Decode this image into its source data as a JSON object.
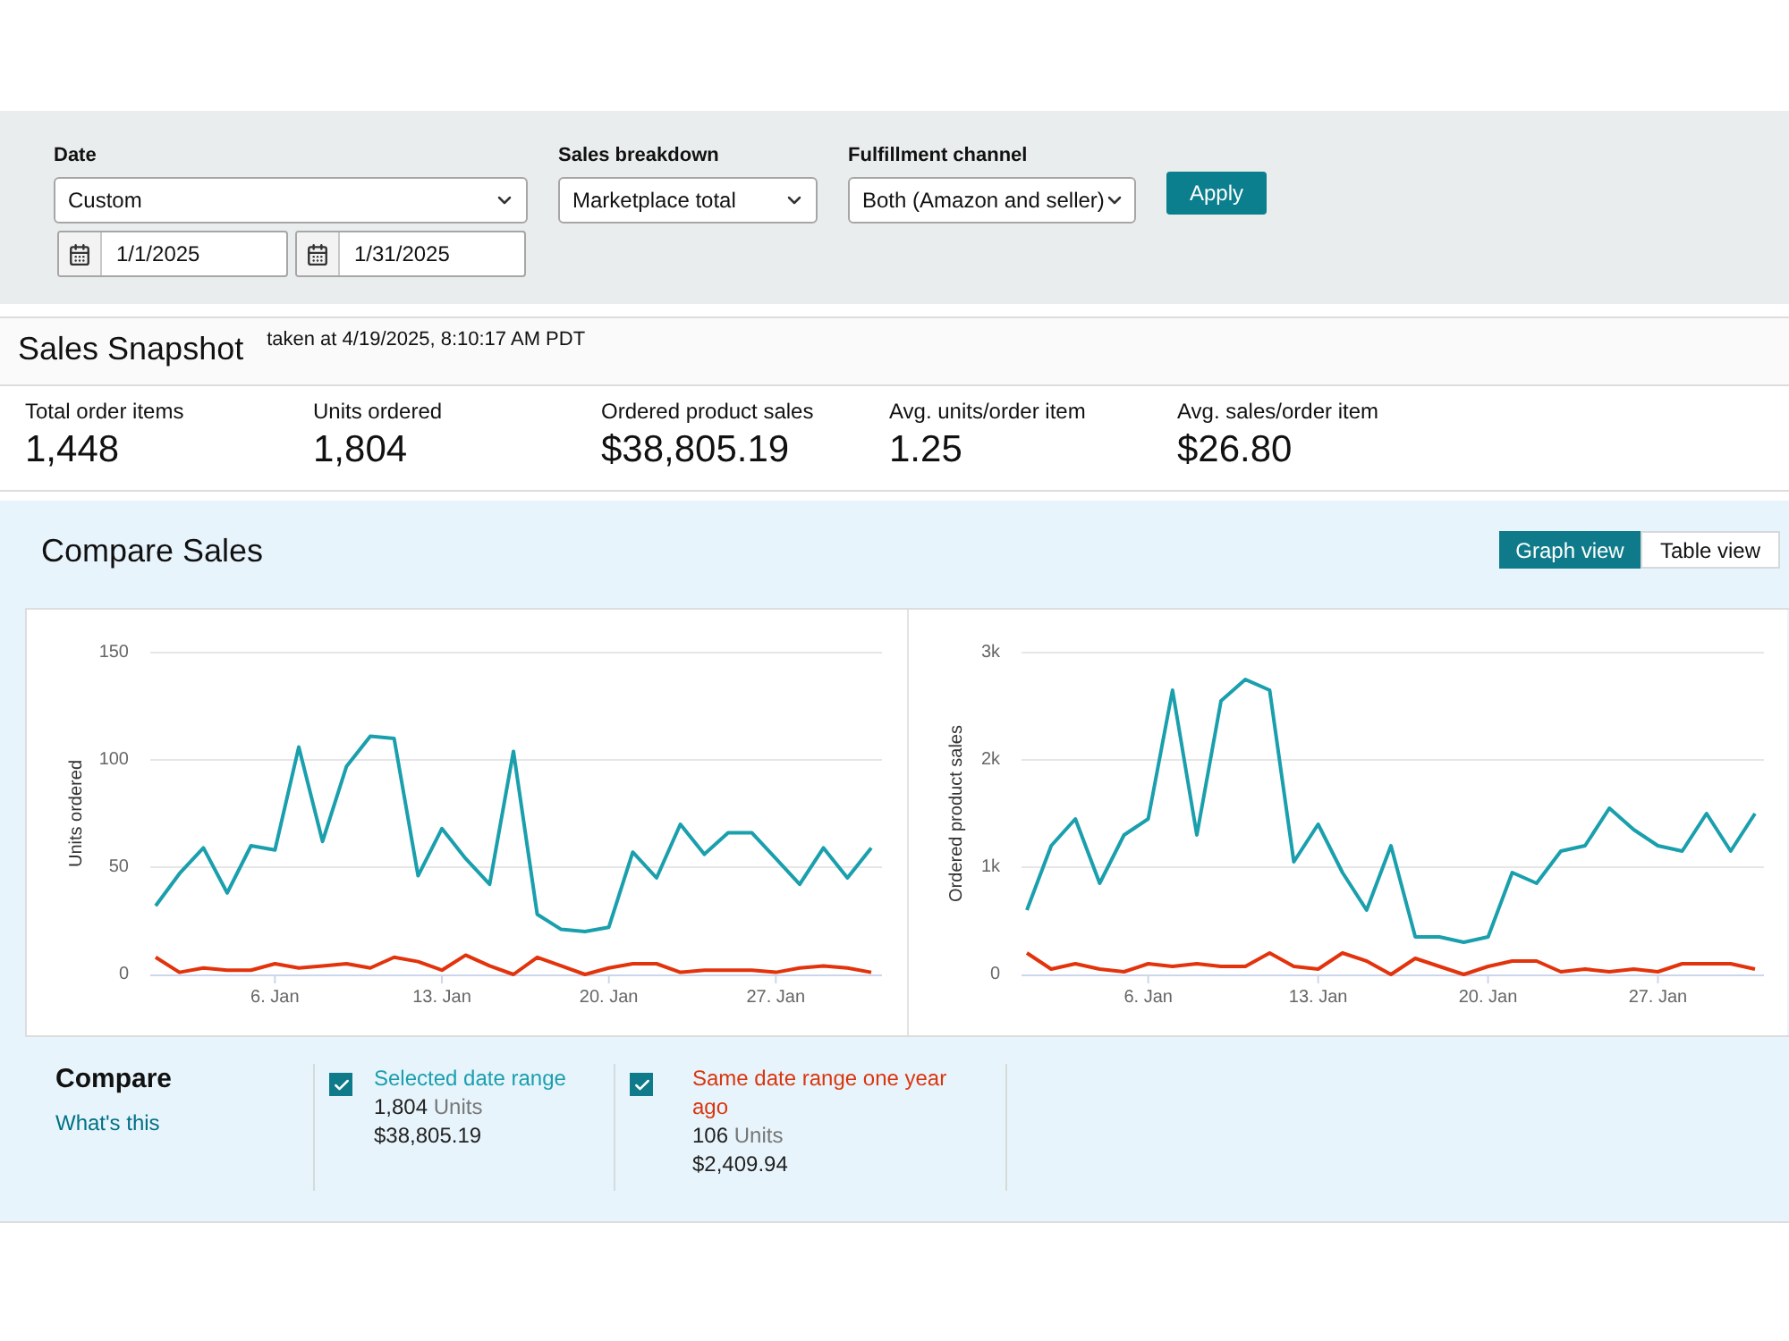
{
  "filters": {
    "date": {
      "label": "Date",
      "value": "Custom",
      "start": "1/1/2025",
      "end": "1/31/2025"
    },
    "sales_breakdown": {
      "label": "Sales breakdown",
      "value": "Marketplace total"
    },
    "fulfillment_channel": {
      "label": "Fulfillment channel",
      "value": "Both (Amazon and seller)"
    },
    "apply_button": "Apply"
  },
  "snapshot": {
    "title": "Sales Snapshot",
    "taken_at": "taken at 4/19/2025, 8:10:17 AM PDT",
    "metrics": [
      {
        "label": "Total order items",
        "value": "1,448"
      },
      {
        "label": "Units ordered",
        "value": "1,804"
      },
      {
        "label": "Ordered product sales",
        "value": "$38,805.19"
      },
      {
        "label": "Avg. units/order item",
        "value": "1.25"
      },
      {
        "label": "Avg. sales/order item",
        "value": "$26.80"
      }
    ]
  },
  "compare_sales": {
    "title": "Compare Sales",
    "view_toggle": [
      {
        "label": "Graph view",
        "selected": true
      },
      {
        "label": "Table view",
        "selected": false
      }
    ],
    "charts": [
      {
        "chart_data": {
          "type": "line",
          "ylabel": "Units ordered",
          "categories": [
            null,
            null,
            null,
            null,
            null,
            "6. Jan",
            null,
            null,
            null,
            null,
            null,
            null,
            "13. Jan",
            null,
            null,
            null,
            null,
            null,
            null,
            "20. Jan",
            null,
            null,
            null,
            null,
            null,
            null,
            "27. Jan",
            null,
            null,
            null,
            null
          ],
          "ylim": [
            0,
            150
          ],
          "yticks": [
            0,
            50,
            100,
            150
          ],
          "series": [
            {
              "color": "#1a9fad",
              "values": [
                32,
                47,
                59,
                38,
                60,
                58,
                106,
                62,
                97,
                111,
                110,
                46,
                68,
                54,
                42,
                104,
                28,
                21,
                20,
                22,
                57,
                45,
                70,
                56,
                66,
                66,
                54,
                42,
                59,
                45,
                59
              ]
            },
            {
              "color": "#e2330c",
              "values": [
                8,
                1,
                3,
                2,
                2,
                5,
                3,
                4,
                5,
                3,
                8,
                6,
                2,
                9,
                4,
                0,
                8,
                4,
                0,
                3,
                5,
                5,
                1,
                2,
                2,
                2,
                1,
                3,
                4,
                3,
                1
              ]
            }
          ]
        }
      },
      {
        "chart_data": {
          "type": "line",
          "ylabel": "Ordered product sales",
          "categories": [
            null,
            null,
            null,
            null,
            null,
            "6. Jan",
            null,
            null,
            null,
            null,
            null,
            null,
            "13. Jan",
            null,
            null,
            null,
            null,
            null,
            null,
            "20. Jan",
            null,
            null,
            null,
            null,
            null,
            null,
            "27. Jan",
            null,
            null,
            null,
            null
          ],
          "ylim": [
            0,
            3000
          ],
          "yticks": [
            {
              "value": 0,
              "label": "0"
            },
            {
              "value": 1000,
              "label": "1k"
            },
            {
              "value": 2000,
              "label": "2k"
            },
            {
              "value": 3000,
              "label": "3k"
            }
          ],
          "series": [
            {
              "color": "#1a9fad",
              "values": [
                600,
                1200,
                1450,
                850,
                1300,
                1450,
                2650,
                1300,
                2550,
                2750,
                2650,
                1050,
                1400,
                950,
                600,
                1200,
                350,
                350,
                300,
                350,
                950,
                850,
                1150,
                1200,
                1550,
                1350,
                1200,
                1150,
                1500,
                1150,
                1500
              ]
            },
            {
              "color": "#e2330c",
              "values": [
                200,
                50,
                100,
                50,
                25,
                100,
                75,
                100,
                75,
                75,
                200,
                75,
                50,
                200,
                125,
                0,
                150,
                75,
                0,
                75,
                125,
                125,
                25,
                50,
                25,
                50,
                25,
                100,
                100,
                100,
                50
              ]
            }
          ]
        }
      }
    ],
    "legend": {
      "title": "Compare",
      "link": "What's this",
      "items": [
        {
          "checked": true,
          "label": "Selected date range",
          "color": "#1a9fad",
          "units": "1,804",
          "units_label": "Units",
          "amount": "$38,805.19"
        },
        {
          "checked": true,
          "label": "Same date range one year ago",
          "color": "#d9360e",
          "units": "106",
          "units_label": "Units",
          "amount": "$2,409.94"
        }
      ]
    }
  }
}
